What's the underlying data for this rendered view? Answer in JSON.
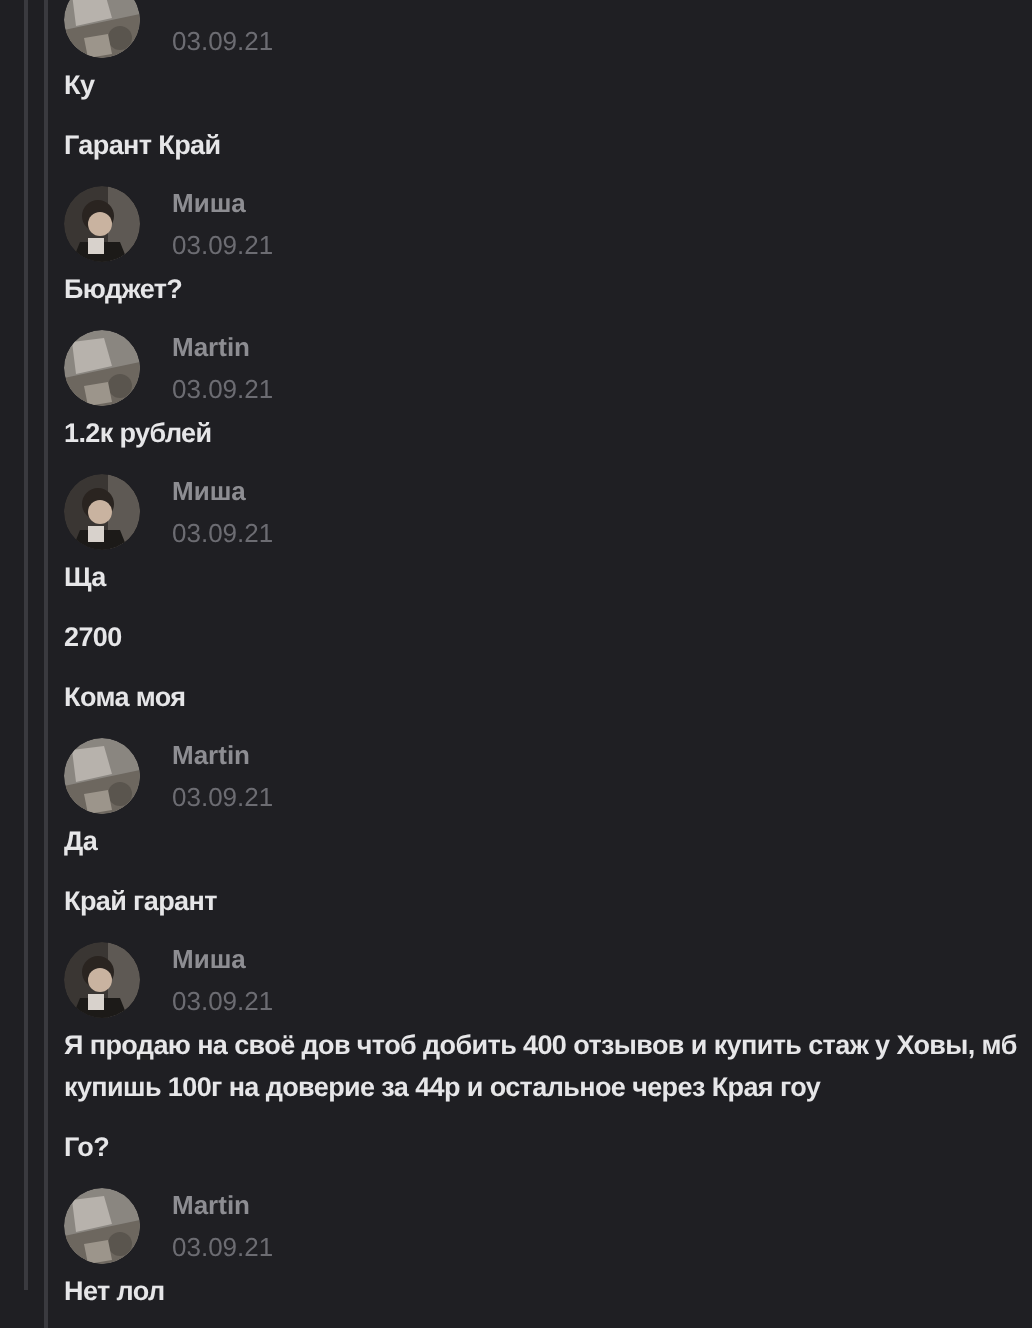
{
  "groups": [
    {
      "date": "03.09.21",
      "messages": [
        "Ку",
        "Гарант Край"
      ]
    },
    {
      "author": "Миша",
      "date": "03.09.21",
      "messages": [
        "Бюджет?"
      ]
    },
    {
      "author": "Martin",
      "date": "03.09.21",
      "messages": [
        "1.2к рублей"
      ]
    },
    {
      "author": "Миша",
      "date": "03.09.21",
      "messages": [
        "Ща",
        "2700",
        "Кома моя"
      ]
    },
    {
      "author": "Martin",
      "date": "03.09.21",
      "messages": [
        "Да",
        "Край гарант"
      ]
    },
    {
      "author": "Миша",
      "date": "03.09.21",
      "messages": [
        "Я продаю на своё дов чтоб добить 400 отзывов и купить стаж у Ховы, мб купишь 100г на доверие за 44р и остальное через Края гоу",
        "Го?"
      ]
    },
    {
      "author": "Martin",
      "date": "03.09.21",
      "messages": [
        "Нет лол"
      ]
    }
  ]
}
